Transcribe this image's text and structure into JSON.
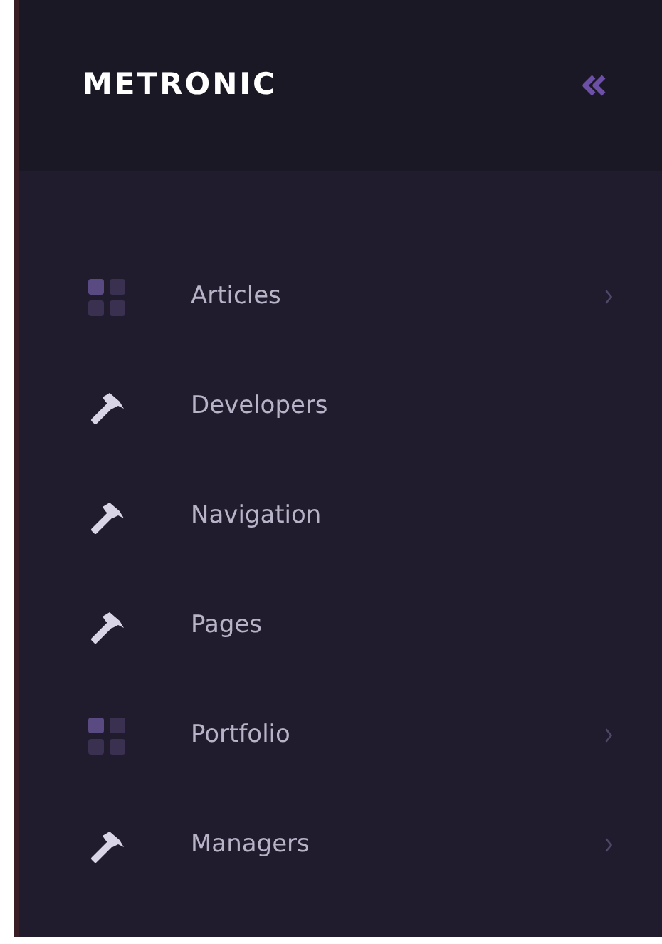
{
  "brand": {
    "title": "METRONIC"
  },
  "sidebar": {
    "items": [
      {
        "label": "Articles",
        "kind": "grid",
        "has_submenu": true
      },
      {
        "label": "Developers",
        "kind": "hammer",
        "has_submenu": false
      },
      {
        "label": "Navigation",
        "kind": "hammer",
        "has_submenu": false
      },
      {
        "label": "Pages",
        "kind": "hammer",
        "has_submenu": false
      },
      {
        "label": "Portfolio",
        "kind": "grid",
        "has_submenu": true
      },
      {
        "label": "Managers",
        "kind": "hammer",
        "has_submenu": true
      }
    ]
  }
}
